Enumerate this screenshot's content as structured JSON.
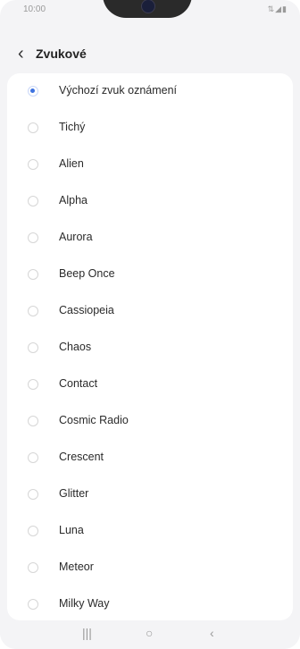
{
  "status_bar": {
    "time": "10:00",
    "icons": "⇅◢▮"
  },
  "header": {
    "back_icon": "‹",
    "title": "Zvukové"
  },
  "list": {
    "items": [
      {
        "label": "Výchozí zvuk oznámení",
        "selected": true
      },
      {
        "label": "Tichý",
        "selected": false
      },
      {
        "label": "Alien",
        "selected": false
      },
      {
        "label": "Alpha",
        "selected": false
      },
      {
        "label": "Aurora",
        "selected": false
      },
      {
        "label": "Beep Once",
        "selected": false
      },
      {
        "label": "Cassiopeia",
        "selected": false
      },
      {
        "label": "Chaos",
        "selected": false
      },
      {
        "label": "Contact",
        "selected": false
      },
      {
        "label": "Cosmic Radio",
        "selected": false
      },
      {
        "label": "Crescent",
        "selected": false
      },
      {
        "label": "Glitter",
        "selected": false
      },
      {
        "label": "Luna",
        "selected": false
      },
      {
        "label": "Meteor",
        "selected": false
      },
      {
        "label": "Milky Way",
        "selected": false
      }
    ]
  },
  "nav_bar": {
    "recents": "|||",
    "home": "○",
    "back": "‹"
  },
  "colors": {
    "accent": "#3e73e0",
    "background": "#f4f4f6",
    "card": "#ffffff"
  }
}
